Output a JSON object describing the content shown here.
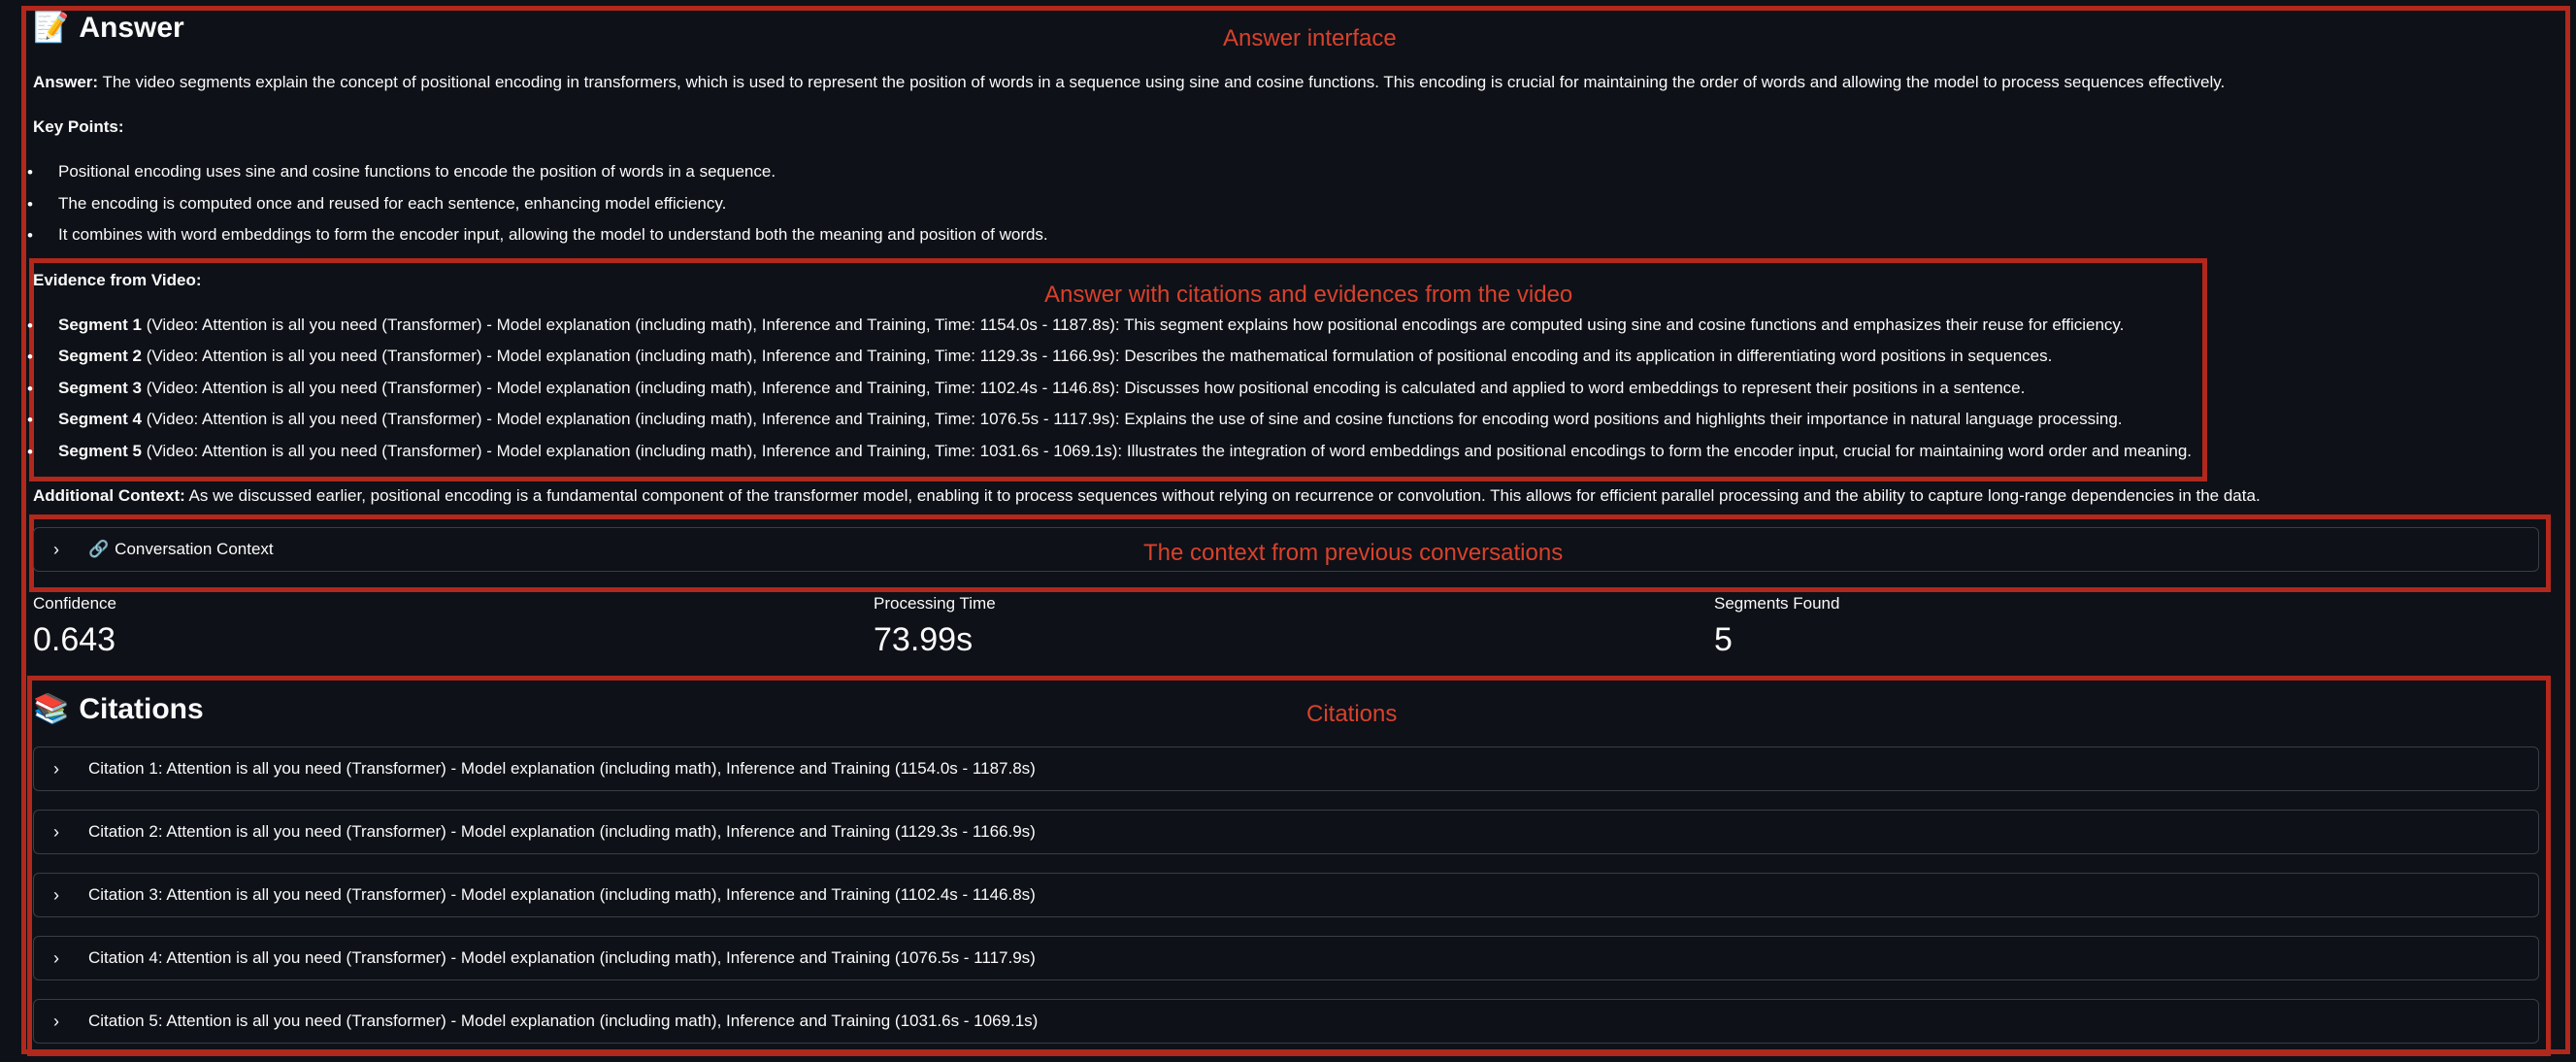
{
  "answer_section": {
    "icon": "memo-icon",
    "icon_glyph": "📝",
    "title": "Answer",
    "answer_label": "Answer:",
    "answer_text": " The video segments explain the concept of positional encoding in transformers, which is used to represent the position of words in a sequence using sine and cosine functions. This encoding is crucial for maintaining the order of words and allowing the model to process sequences effectively.",
    "key_points_label": "Key Points:",
    "key_points": [
      "Positional encoding uses sine and cosine functions to encode the position of words in a sequence.",
      "The encoding is computed once and reused for each sentence, enhancing model efficiency.",
      "It combines with word embeddings to form the encoder input, allowing the model to understand both the meaning and position of words."
    ],
    "evidence_label": "Evidence from Video:",
    "segments": [
      {
        "label": "Segment 1",
        "text": " (Video: Attention is all you need (Transformer) - Model explanation (including math), Inference and Training, Time: 1154.0s - 1187.8s): This segment explains how positional encodings are computed using sine and cosine functions and emphasizes their reuse for efficiency."
      },
      {
        "label": "Segment 2",
        "text": " (Video: Attention is all you need (Transformer) - Model explanation (including math), Inference and Training, Time: 1129.3s - 1166.9s): Describes the mathematical formulation of positional encoding and its application in differentiating word positions in sequences."
      },
      {
        "label": "Segment 3",
        "text": " (Video: Attention is all you need (Transformer) - Model explanation (including math), Inference and Training, Time: 1102.4s - 1146.8s): Discusses how positional encoding is calculated and applied to word embeddings to represent their positions in a sentence."
      },
      {
        "label": "Segment 4",
        "text": " (Video: Attention is all you need (Transformer) - Model explanation (including math), Inference and Training, Time: 1076.5s - 1117.9s): Explains the use of sine and cosine functions for encoding word positions and highlights their importance in natural language processing."
      },
      {
        "label": "Segment 5",
        "text": " (Video: Attention is all you need (Transformer) - Model explanation (including math), Inference and Training, Time: 1031.6s - 1069.1s): Illustrates the integration of word embeddings and positional encodings to form the encoder input, crucial for maintaining word order and meaning."
      }
    ],
    "additional_label": "Additional Context:",
    "additional_text": " As we discussed earlier, positional encoding is a fundamental component of the transformer model, enabling it to process sequences without relying on recurrence or convolution. This allows for efficient parallel processing and the ability to capture long-range dependencies in the data."
  },
  "conversation_context": {
    "icon": "link-icon",
    "icon_glyph": "🔗",
    "label": "Conversation Context"
  },
  "metrics": {
    "confidence_label": "Confidence",
    "confidence_value": "0.643",
    "processing_label": "Processing Time",
    "processing_value": "73.99s",
    "segments_label": "Segments Found",
    "segments_value": "5"
  },
  "citations_section": {
    "icon": "books-icon",
    "icon_glyph": "📚",
    "title": "Citations",
    "items": [
      "Citation 1: Attention is all you need (Transformer) - Model explanation (including math), Inference and Training (1154.0s - 1187.8s)",
      "Citation 2: Attention is all you need (Transformer) - Model explanation (including math), Inference and Training (1129.3s - 1166.9s)",
      "Citation 3: Attention is all you need (Transformer) - Model explanation (including math), Inference and Training (1102.4s - 1146.8s)",
      "Citation 4: Attention is all you need (Transformer) - Model explanation (including math), Inference and Training (1076.5s - 1117.9s)",
      "Citation 5: Attention is all you need (Transformer) - Model explanation (including math), Inference and Training (1031.6s - 1069.1s)"
    ]
  },
  "annotations": {
    "answer_interface": "Answer interface",
    "citations_evidence": "Answer with citations and evidences from the video",
    "previous_context": "The context from previous conversations",
    "citations": "Citations"
  },
  "colors": {
    "background": "#0e1117",
    "text": "#fafafa",
    "annotation_border": "#b1281c",
    "annotation_text": "#d9412c",
    "expander_border": "#3a3d47"
  }
}
